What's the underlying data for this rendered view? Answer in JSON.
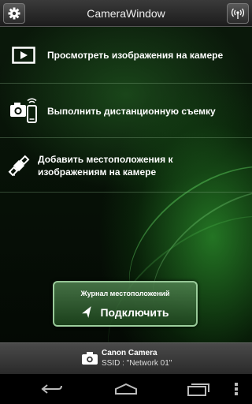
{
  "header": {
    "title": "CameraWindow",
    "settings_icon": "gear-icon",
    "wireless_icon": "wireless-status-icon"
  },
  "menu": [
    {
      "icon": "image-viewer-icon",
      "label": "Просмотреть изображения на камере"
    },
    {
      "icon": "camera-phone-icon",
      "label": "Выполнить дистанционную съемку"
    },
    {
      "icon": "satellite-location-icon",
      "label": "Добавить местоположения к изображениям на камере"
    }
  ],
  "location_log": {
    "caption": "Журнал местоположений",
    "button_label": "Подключить",
    "icon": "location-arrow-icon"
  },
  "connection": {
    "camera_name": "Canon Camera",
    "ssid": "SSID : \"Network 01\"",
    "icon": "camera-icon"
  },
  "navbar": {
    "back_icon": "back-icon",
    "home_icon": "home-icon",
    "recents_icon": "recent-apps-icon",
    "menu_icon": "overflow-menu-icon"
  },
  "colors": {
    "accent_green": "#3cc83c",
    "header_gray": "#2a2a2a"
  }
}
